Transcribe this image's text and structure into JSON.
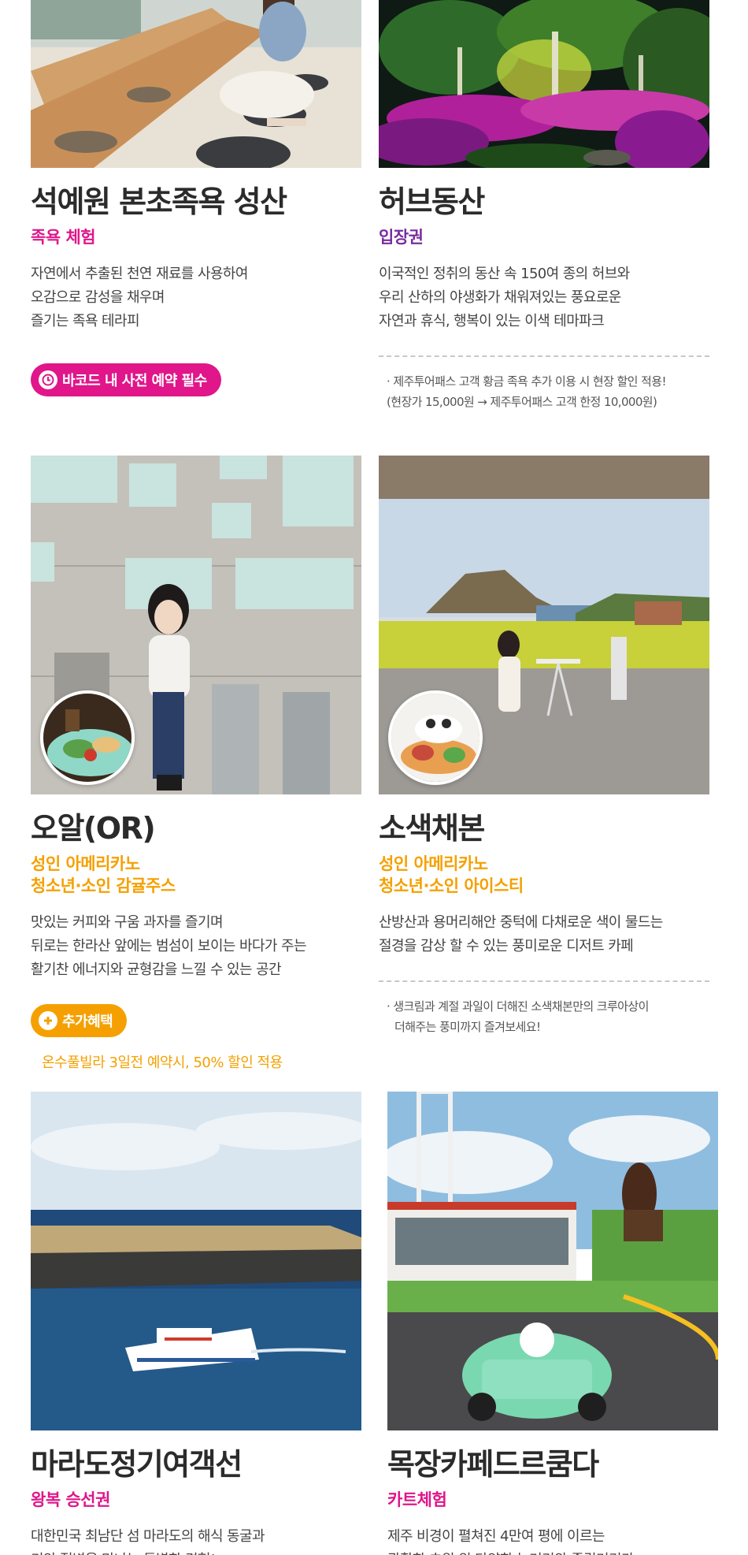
{
  "cards": [
    {
      "title": "석예원 본초족욕 성산",
      "subtitle": "족욕 체험",
      "desc": [
        "자연에서 추출된 천연 재료를 사용하여",
        "오감으로 감성을 채우며",
        "즐기는 족욕 테라피"
      ],
      "badge": "바코드 내 사전 예약 필수"
    },
    {
      "title": "허브동산",
      "subtitle": "입장권",
      "desc": [
        "이국적인 정취의 동산 속 150여 종의 허브와",
        "우리 산하의 야생화가 채워져있는 풍요로운",
        "자연과 휴식, 행복이 있는 이색 테마파크"
      ],
      "note": [
        "· 제주투어패스 고객 황금 족욕 추가 이용 시 현장 할인 적용!",
        "(현장가 15,000원 → 제주투어패스 고객 한정 10,000원)"
      ]
    },
    {
      "title": "오알(OR)",
      "subtitle": [
        "성인 아메리카노",
        "청소년·소인 감귤주스"
      ],
      "desc": [
        "맛있는 커피와 구움 과자를 즐기며",
        "뒤로는 한라산 앞에는 범섬이 보이는 바다가 주는",
        "활기찬 에너지와 균형감을 느낄 수 있는 공간"
      ],
      "badge": "추가혜택",
      "benefit": "온수풀빌라 3일전 예약시, 50% 할인 적용"
    },
    {
      "title": "소색채본",
      "subtitle": [
        "성인 아메리카노",
        "청소년·소인 아이스티"
      ],
      "desc": [
        "산방산과 용머리해안 중턱에 다채로운 색이 물드는",
        "절경을 감상 할 수 있는 풍미로운 디저트 카페"
      ],
      "note": [
        "· 생크림과 계절 과일이 더해진 소색채본만의 크루아상이",
        "더해주는 풍미까지 즐겨보세요!"
      ]
    },
    {
      "title": "마라도정기여객선",
      "subtitle": "왕복 승선권",
      "desc": [
        "대한민국 최남단 섬 마라도의 해식 동굴과",
        "기암 절벽을 만나는 특별한 경험!"
      ]
    },
    {
      "title": "목장카페드르쿰다",
      "subtitle": "카트체험",
      "desc": [
        "제주 비경이 펼쳐진 4만여 평에 이르는",
        "광활한 초원 위 다양한 놀거리와 즐길거리가"
      ]
    }
  ],
  "colors": {
    "pink": "#e0168a",
    "purple": "#7a2d9e",
    "orange": "#f5a000"
  },
  "icons": {
    "clock": "clock-icon",
    "plus": "plus-circle-icon"
  }
}
